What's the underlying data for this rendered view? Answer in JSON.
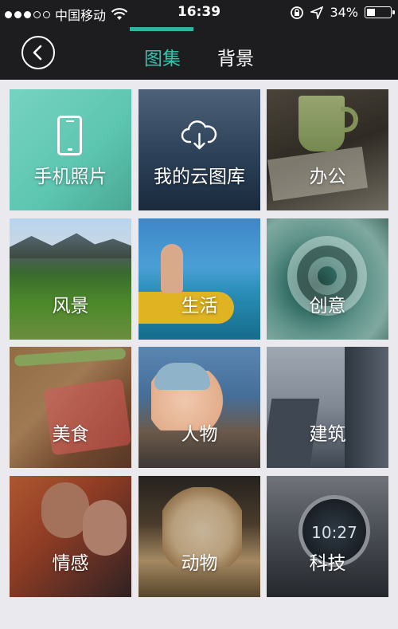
{
  "status_bar": {
    "carrier": "中国移动",
    "time": "16:39",
    "battery_percent": "34%",
    "battery_level": 0.34,
    "icons": [
      "signal-dots-icon",
      "wifi-icon",
      "rotation-lock-icon",
      "location-arrow-icon",
      "battery-icon"
    ]
  },
  "nav": {
    "back_icon": "chevron-left-icon",
    "tabs": [
      {
        "label": "图集",
        "active": true
      },
      {
        "label": "背景",
        "active": false
      }
    ],
    "accent_color": "#34c3ad"
  },
  "categories": [
    {
      "label": "手机照片",
      "icon": "phone-icon"
    },
    {
      "label": "我的云图库",
      "icon": "cloud-download-icon"
    },
    {
      "label": "办公"
    },
    {
      "label": "风景"
    },
    {
      "label": "生活"
    },
    {
      "label": "创意"
    },
    {
      "label": "美食"
    },
    {
      "label": "人物"
    },
    {
      "label": "建筑"
    },
    {
      "label": "情感"
    },
    {
      "label": "动物"
    },
    {
      "label": "科技",
      "watch_time": "10:27"
    }
  ]
}
